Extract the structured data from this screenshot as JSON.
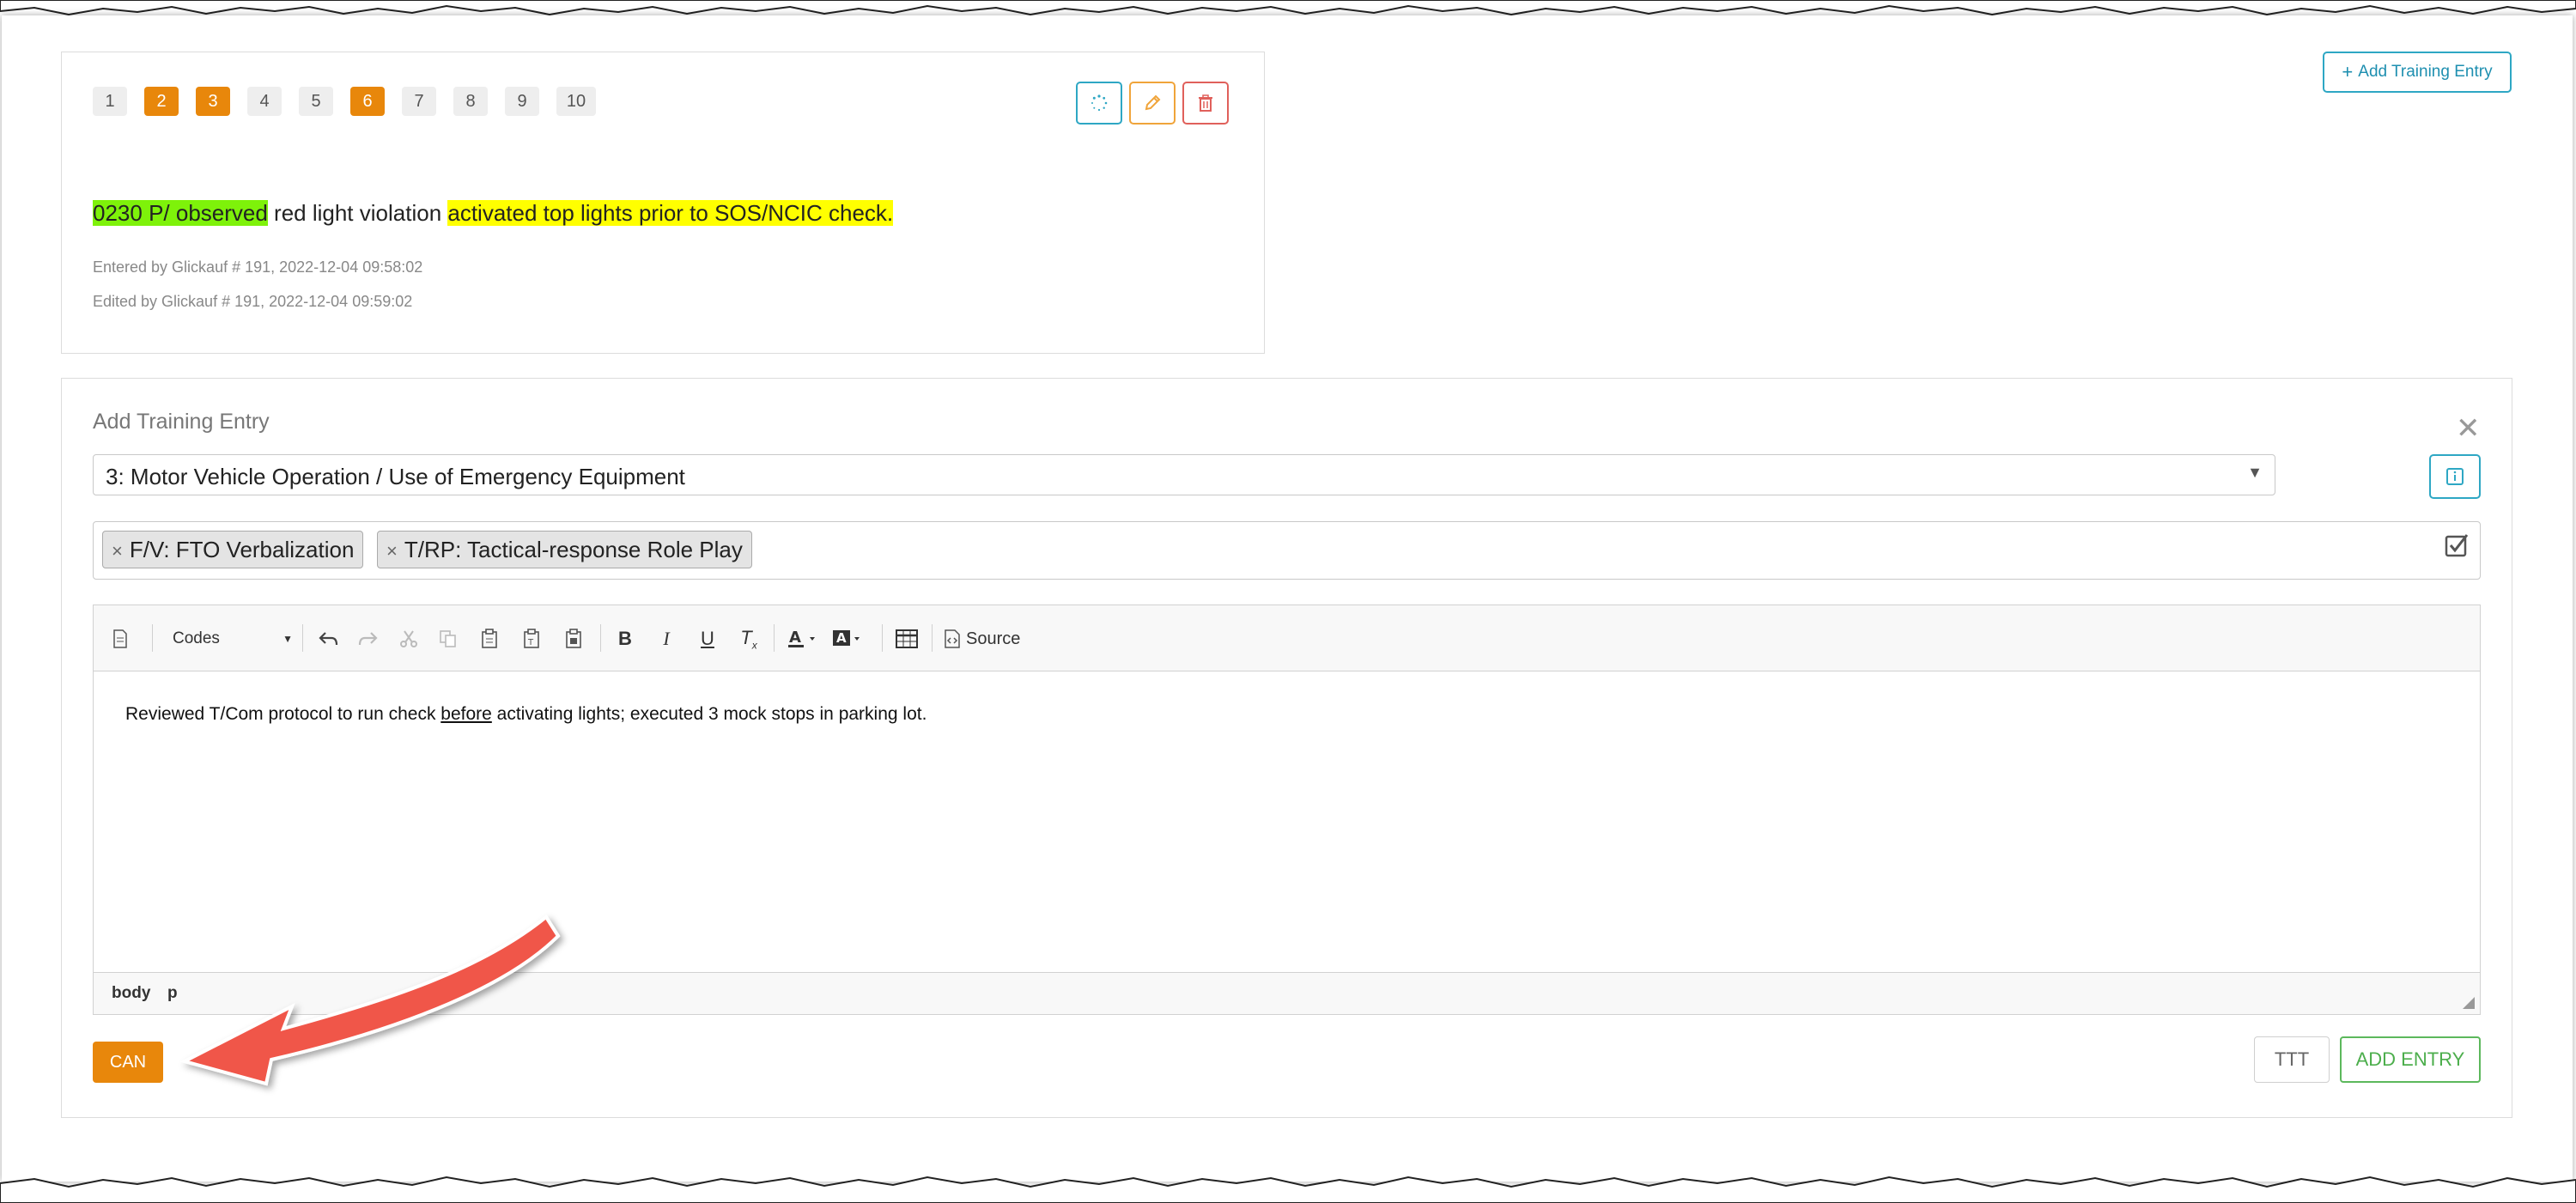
{
  "entry_card": {
    "ratings": [
      "1",
      "2",
      "3",
      "4",
      "5",
      "6",
      "7",
      "8",
      "9",
      "10"
    ],
    "selected_ratings": [
      "2",
      "3",
      "6"
    ],
    "text_part1": "0230 P/ observed",
    "text_part2": " red light violation ",
    "text_part3": "activated top lights prior to SOS/NCIC check.",
    "entered_by": "Entered by Glickauf # 191, 2022-12-04 09:58:02",
    "edited_by": "Edited by Glickauf # 191, 2022-12-04 09:59:02",
    "actions": [
      "spinner-icon",
      "pencil-icon",
      "trash-icon"
    ]
  },
  "header": {
    "add_training_entry_label": "Add Training Entry"
  },
  "add_panel": {
    "title": "Add Training Entry",
    "category_selected": "3: Motor Vehicle Operation / Use of Emergency Equipment",
    "tags": [
      "F/V: FTO Verbalization",
      "T/RP: Tactical-response Role Play"
    ],
    "editor": {
      "format_dropdown": "Codes",
      "source_label": "Source",
      "content_before": "Reviewed T/Com protocol to run check ",
      "content_underlined": "before",
      "content_after": " activating lights; executed 3 mock stops in parking lot.",
      "path": [
        "body",
        "p"
      ]
    },
    "cancel_label": "CAN",
    "ttt_label": "TTT",
    "add_entry_label": "ADD ENTRY"
  },
  "colors": {
    "accent_orange": "#e8870b",
    "teal": "#2ea7c4",
    "green": "#5cb85c",
    "highlight_green": "#7ef20a",
    "highlight_yellow": "#ffff00",
    "annotation_arrow": "#f0564a"
  }
}
